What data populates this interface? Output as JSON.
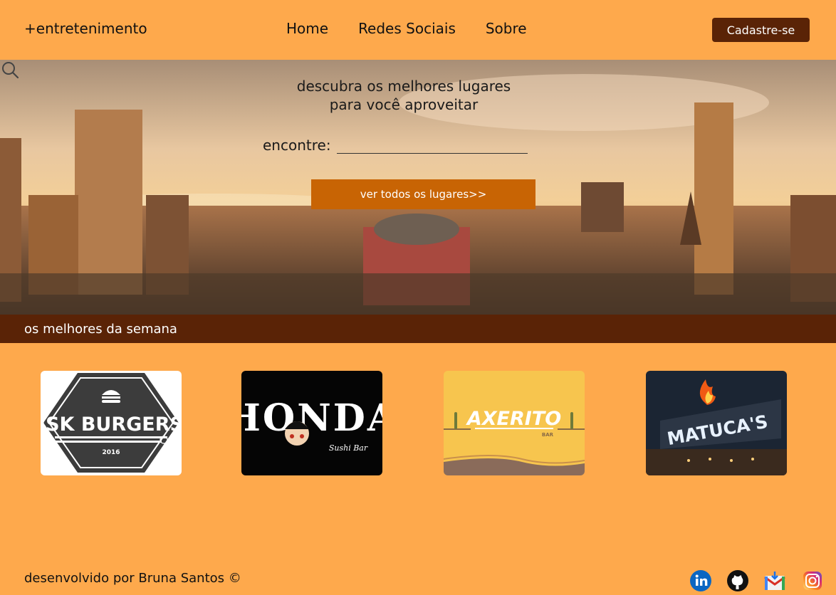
{
  "header": {
    "brand": "+entretenimento",
    "nav": [
      "Home",
      "Redes Sociais",
      "Sobre"
    ],
    "signup_label": "Cadastre-se"
  },
  "hero": {
    "title_line1": "descubra os melhores lugares",
    "title_line2": "para você aproveitar",
    "find_label": "encontre:",
    "find_value": "",
    "find_placeholder": "",
    "all_places_label": "ver todos os lugares>>"
  },
  "week": {
    "title": "os melhores da semana",
    "cards": [
      {
        "name": "JSK BURGERS",
        "year": "2016",
        "icon": "burger-logo"
      },
      {
        "name": "HONDA",
        "sub": "Sushi Bar",
        "icon": "sushi-logo"
      },
      {
        "name": "AXERITO",
        "sub": "BAR",
        "icon": "cactus-logo"
      },
      {
        "name": "MATUCA'S",
        "icon": "flame-logo"
      }
    ]
  },
  "footer": {
    "credit": "desenvolvido por Bruna Santos  ©",
    "social": [
      "linkedin-icon",
      "github-icon",
      "gmail-icon",
      "instagram-icon"
    ]
  },
  "colors": {
    "background": "#fea94c",
    "accent_dark": "#5a2306",
    "button": "#c86404"
  }
}
